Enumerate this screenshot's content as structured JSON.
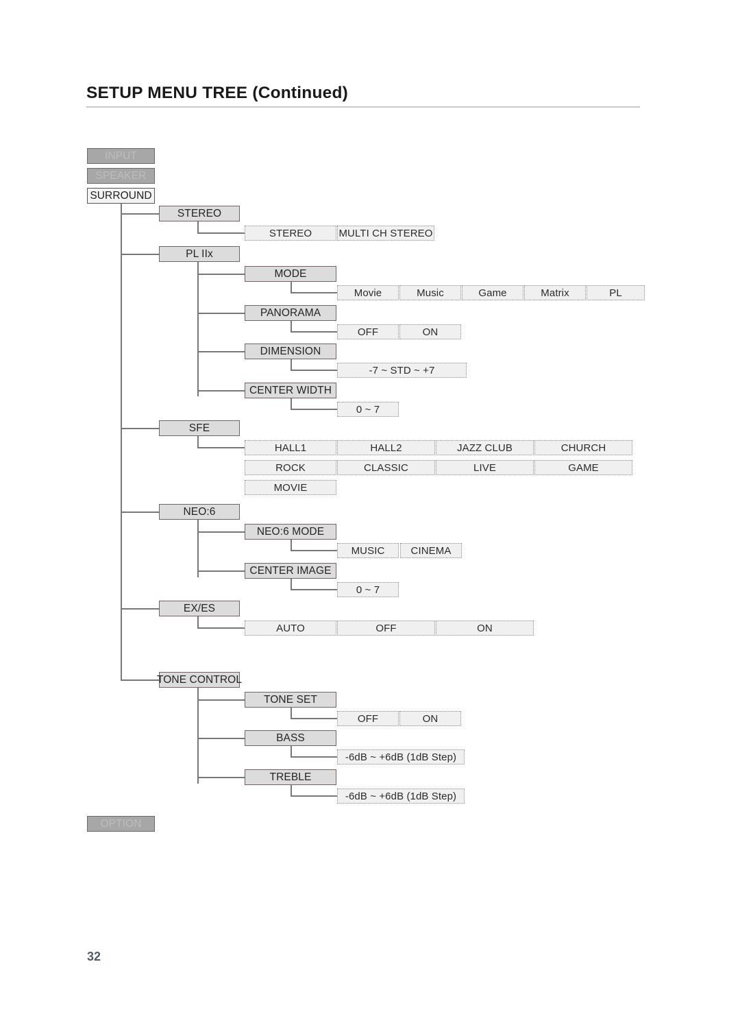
{
  "header": {
    "title": "SETUP MENU TREE (Continued)"
  },
  "page_number": "32",
  "roots": {
    "input": "INPUT",
    "speaker": "SPEAKER",
    "surround": "SURROUND",
    "option": "OPTION"
  },
  "tree": {
    "surround_children": [
      {
        "label": "STEREO"
      },
      {
        "label": "PL IIx"
      },
      {
        "label": "SFE"
      },
      {
        "label": "NEO:6"
      },
      {
        "label": "EX/ES"
      },
      {
        "label": "TONE CONTROL"
      }
    ],
    "stereo_values": [
      "STEREO",
      "MULTI CH STEREO"
    ],
    "pliix_children": [
      {
        "label": "MODE"
      },
      {
        "label": "PANORAMA"
      },
      {
        "label": "DIMENSION"
      },
      {
        "label": "CENTER WIDTH"
      }
    ],
    "mode_values": [
      "Movie",
      "Music",
      "Game",
      "Matrix",
      "PL"
    ],
    "panorama_values": [
      "OFF",
      "ON"
    ],
    "dimension_values": [
      "-7 ~ STD ~ +7"
    ],
    "center_width_values": [
      "0 ~ 7"
    ],
    "sfe_values_row1": [
      "HALL1",
      "HALL2",
      "JAZZ CLUB",
      "CHURCH"
    ],
    "sfe_values_row2": [
      "ROCK",
      "CLASSIC",
      "LIVE",
      "GAME"
    ],
    "sfe_values_row3": [
      "MOVIE"
    ],
    "neo6_children": [
      {
        "label": "NEO:6 MODE"
      },
      {
        "label": "CENTER IMAGE"
      }
    ],
    "neo6_mode_values": [
      "MUSIC",
      "CINEMA"
    ],
    "center_image_values": [
      "0 ~ 7"
    ],
    "exes_values": [
      "AUTO",
      "OFF",
      "ON"
    ],
    "tone_children": [
      {
        "label": "TONE SET"
      },
      {
        "label": "BASS"
      },
      {
        "label": "TREBLE"
      }
    ],
    "tone_set_values": [
      "OFF",
      "ON"
    ],
    "bass_values": [
      "-6dB ~ +6dB (1dB Step)"
    ],
    "treble_values": [
      "-6dB ~ +6dB (1dB Step)"
    ]
  }
}
